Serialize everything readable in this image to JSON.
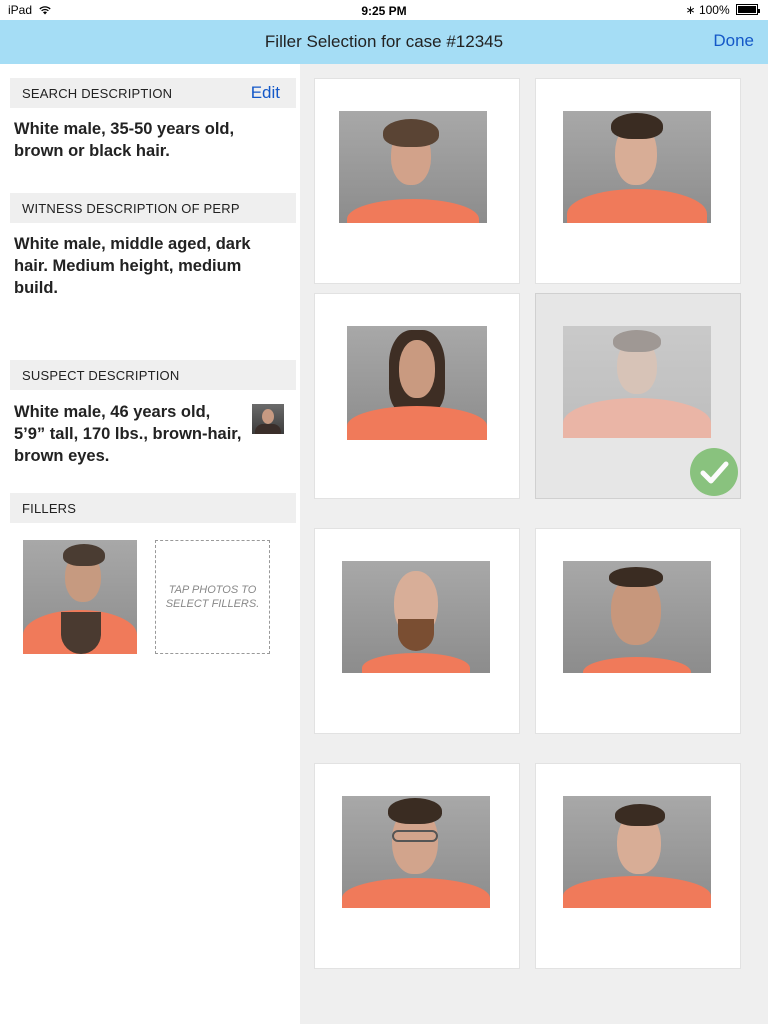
{
  "status": {
    "device": "iPad",
    "time": "9:25 PM",
    "battery": "100%"
  },
  "nav": {
    "title": "Filler Selection for case #12345",
    "done": "Done"
  },
  "search": {
    "header": "SEARCH DESCRIPTION",
    "edit": "Edit",
    "text": "White male, 35-50 years old, brown or black hair."
  },
  "witness": {
    "header": "WITNESS DESCRIPTION OF PERP",
    "text": "White male, middle aged, dark hair. Medium height, medium build."
  },
  "suspect": {
    "header": "SUSPECT DESCRIPTION",
    "text": "White male, 46 years old, 5’9” tall, 170 lbs., brown-hair, brown eyes."
  },
  "fillers": {
    "header": "FILLERS",
    "placeholder": "TAP PHOTOS TO SELECT FILLERS."
  },
  "grid": {
    "photos": [
      {
        "name": "mugshot-1",
        "selected": false
      },
      {
        "name": "mugshot-2",
        "selected": false
      },
      {
        "name": "mugshot-3",
        "selected": false
      },
      {
        "name": "mugshot-4",
        "selected": true
      },
      {
        "name": "mugshot-5",
        "selected": false
      },
      {
        "name": "mugshot-6",
        "selected": false
      },
      {
        "name": "mugshot-7",
        "selected": false
      },
      {
        "name": "mugshot-8",
        "selected": false
      }
    ]
  },
  "colors": {
    "nav_bg": "#a5ddf5",
    "accent": "#1458c8",
    "check": "#7fbf73",
    "shirt": "#f07a5a"
  }
}
